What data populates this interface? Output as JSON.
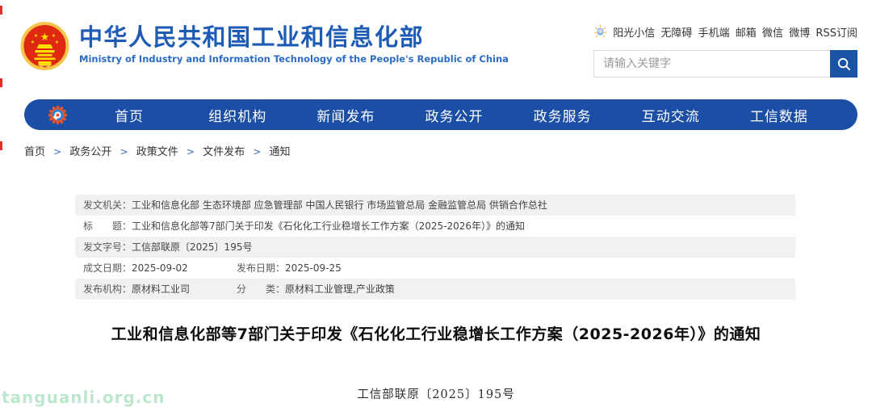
{
  "header": {
    "title_cn": "中华人民共和国工业和信息化部",
    "title_en": "Ministry of Industry and Information Technology of the People's Republic of China",
    "quick_links": [
      "阳光小信",
      "无障碍",
      "手机端",
      "邮箱",
      "微信",
      "微博",
      "RSS订阅"
    ],
    "search": {
      "placeholder": "请输入关键字"
    }
  },
  "nav": {
    "items": [
      "首页",
      "组织机构",
      "新闻发布",
      "政务公开",
      "政务服务",
      "互动交流",
      "工信数据"
    ]
  },
  "breadcrumb": {
    "separator": ">",
    "items": [
      "首页",
      "政务公开",
      "政策文件",
      "文件发布",
      "通知"
    ]
  },
  "meta_table": {
    "rows": [
      {
        "label": "发文机关：",
        "value": "工业和信息化部 生态环境部 应急管理部 中国人民银行 市场监管总局 金融监管总局 供销合作总社"
      },
      {
        "label": "标　　题：",
        "value": "工业和信息化部等7部门关于印发《石化化工行业稳增长工作方案（2025-2026年）》的通知"
      },
      {
        "label": "发文字号：",
        "value": "工信部联原〔2025〕195号"
      },
      {
        "label": "成文日期：",
        "value": "2025-09-02",
        "label2": "发布日期：",
        "value2": "2025-09-25"
      },
      {
        "label": "发布机构：",
        "value": "原材料工业司",
        "label2": "分　　类：",
        "value2": "原材料工业管理,产业政策"
      }
    ]
  },
  "article": {
    "title": "工业和信息化部等7部门关于印发《石化化工行业稳增长工作方案（2025-2026年）》的通知",
    "doc_number": "工信部联原〔2025〕195号"
  },
  "watermark": "tanguanli.org.cn",
  "colors": {
    "nav_blue": "#1b4fa5",
    "title_blue": "#1e5bb4",
    "subtitle_blue": "#2a6cc4",
    "search_button_blue": "#1953a5",
    "table_row_gray": "#f1f1f1",
    "watermark_green": "#bce7cd",
    "emblem_red": "#de2910",
    "emblem_gold": "#ffde00",
    "logo_orange": "#e8542a"
  }
}
